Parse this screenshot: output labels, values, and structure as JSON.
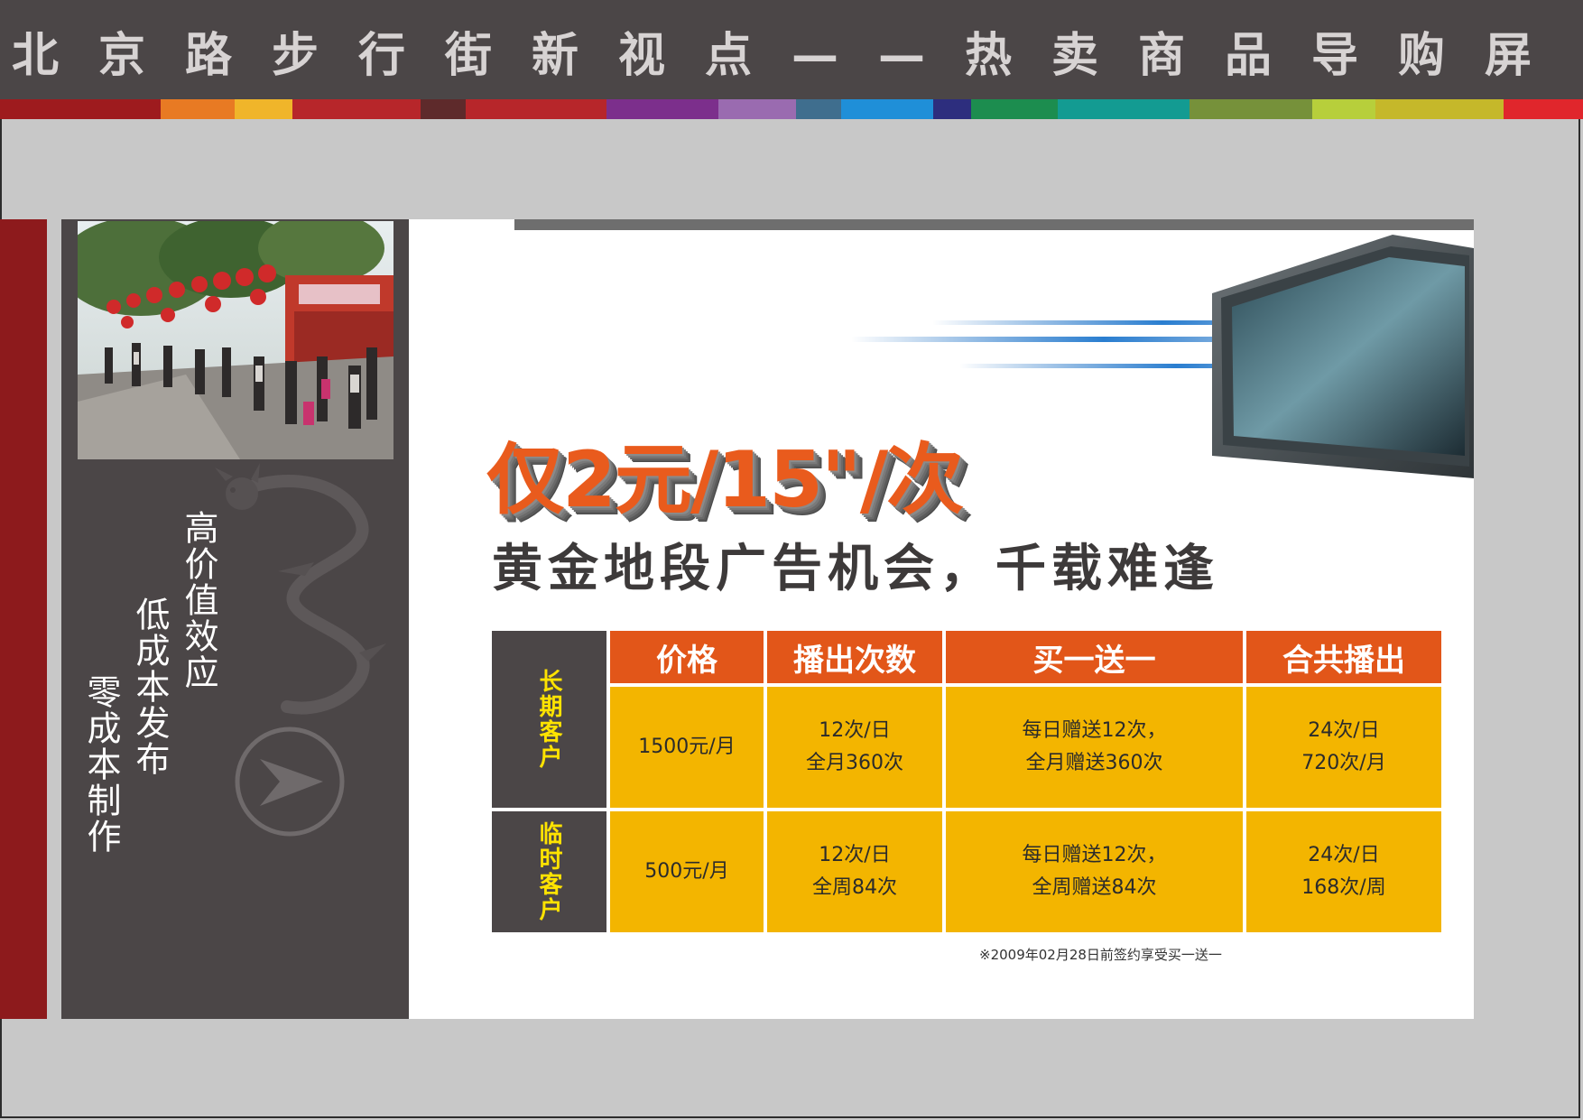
{
  "header": {
    "title": "北京路步行街新视点——热卖商品导购屏"
  },
  "color_strip": [
    "#9e1b1e",
    "#e87a23",
    "#f0b52a",
    "#b7262a",
    "#5e2a2b",
    "#b7262a",
    "#7c2f8c",
    "#9a6bb0",
    "#3f6e8e",
    "#1f8fd8",
    "#2d2e7e",
    "#1c8d4f",
    "#139b92",
    "#76913a",
    "#b7cf3b",
    "#c5b82a",
    "#e0262c"
  ],
  "side_panel": {
    "photo_alt": "",
    "slogans": [
      "高价值效应",
      "低成本发布",
      "零成本制作"
    ]
  },
  "main": {
    "headline": "仅2元/15\"/次",
    "subheadline": "黄金地段广告机会，千载难逢",
    "table": {
      "headers": [
        "价格",
        "播出次数",
        "买一送一",
        "合共播出"
      ],
      "rows": [
        {
          "label": "长期客户",
          "price": "1500元/月",
          "plays": [
            "12次/日",
            "全月360次"
          ],
          "bonus": [
            "每日赠送12次，",
            "全月赠送360次"
          ],
          "total": [
            "24次/日",
            "720次/月"
          ]
        },
        {
          "label": "临时客户",
          "price": "500元/月",
          "plays": [
            "12次/日",
            "全周84次"
          ],
          "bonus": [
            "每日赠送12次，",
            "全周赠送84次"
          ],
          "total": [
            "24次/日",
            "168次/周"
          ]
        }
      ]
    },
    "footnote": "※2009年02月28日前签约享受买一送一"
  },
  "colors": {
    "header_bg": "#4b4647",
    "accent_orange": "#e25619",
    "cell_yellow": "#f3b500",
    "label_yellow": "#ffe300",
    "side_red": "#8d1a1c"
  }
}
